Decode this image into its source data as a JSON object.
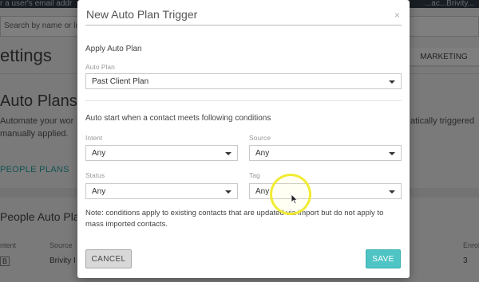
{
  "background": {
    "topbar_hint": "r a user's email addr",
    "topbar_right": "...ac...Brivity...",
    "search_placeholder": "Search by name or li",
    "settings_title": "ettings",
    "marketing_tab": "MARKETING",
    "auto_plans_heading": "Auto Plans",
    "automate_text": "Automate your wor manually applied.",
    "triggered_text": "atically triggered",
    "people_plans_link": "PEOPLE PLANS",
    "people_auto_plans_heading": "People Auto Pla",
    "table_headers": {
      "intent": "ntent",
      "source": "Source",
      "enrolled": "Enrol"
    },
    "row": {
      "intent_badge": "B",
      "source": "Brivity I",
      "enrolled": "3"
    }
  },
  "modal": {
    "title": "New Auto Plan Trigger",
    "close_glyph": "×",
    "apply_section_title": "Apply Auto Plan",
    "auto_plan_label": "Auto Plan",
    "auto_plan_value": "Past Client Plan",
    "conditions_title": "Auto start when a contact meets following conditions",
    "intent_label": "Intent",
    "intent_value": "Any",
    "source_label": "Source",
    "source_value": "Any",
    "status_label": "Status",
    "status_value": "Any",
    "tag_label": "Tag",
    "tag_value": "Any",
    "note": "Note: conditions apply to existing contacts that are updated via import but do not apply to mass imported contacts.",
    "cancel_label": "CANCEL",
    "save_label": "SAVE"
  },
  "colors": {
    "accent": "#4fc4c4",
    "highlight_ring": "#f0eb28"
  }
}
